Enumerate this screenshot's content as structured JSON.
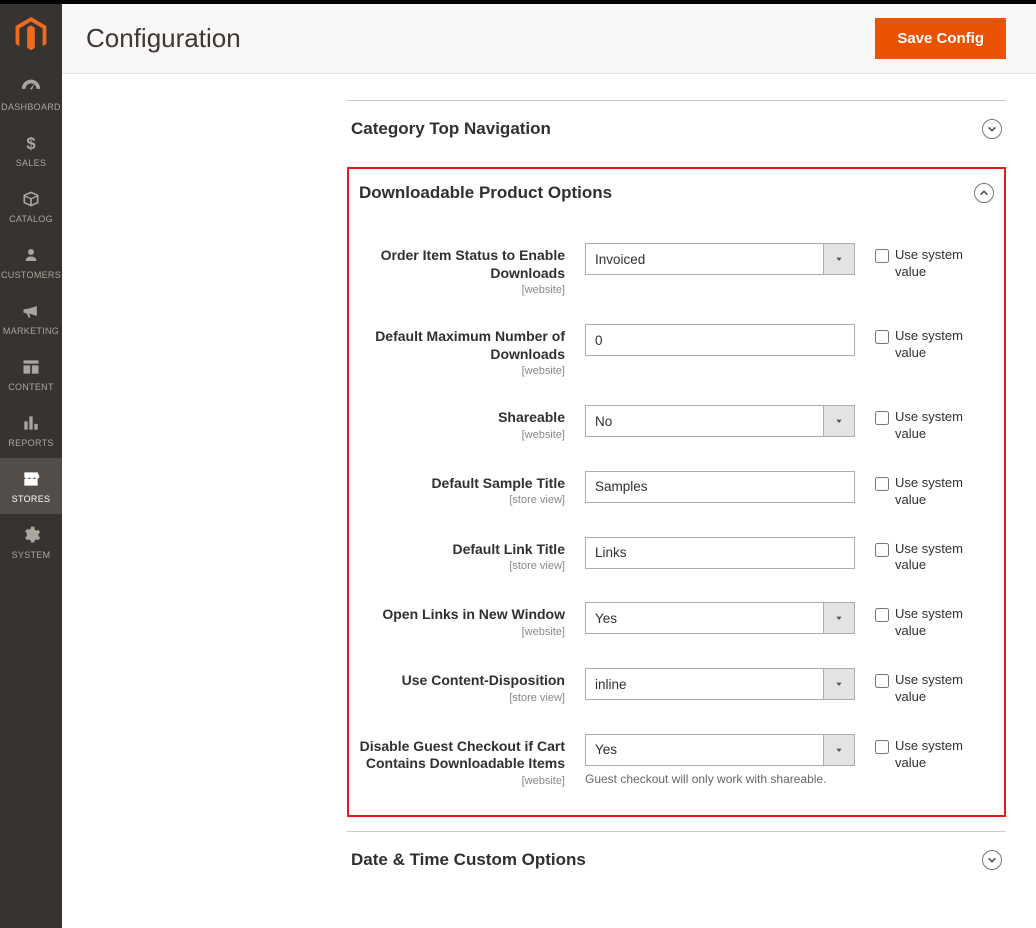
{
  "header": {
    "page_title": "Configuration",
    "save_button": "Save Config"
  },
  "sidebar": {
    "items": [
      {
        "id": "dashboard",
        "label": "DASHBOARD"
      },
      {
        "id": "sales",
        "label": "SALES"
      },
      {
        "id": "catalog",
        "label": "CATALOG"
      },
      {
        "id": "customers",
        "label": "CUSTOMERS"
      },
      {
        "id": "marketing",
        "label": "MARKETING"
      },
      {
        "id": "content",
        "label": "CONTENT"
      },
      {
        "id": "reports",
        "label": "REPORTS"
      },
      {
        "id": "stores",
        "label": "STORES",
        "active": true
      },
      {
        "id": "system",
        "label": "SYSTEM"
      }
    ]
  },
  "sections": {
    "top_nav": {
      "title": "Category Top Navigation",
      "expanded": false
    },
    "download": {
      "title": "Downloadable Product Options",
      "expanded": true
    },
    "datetime": {
      "title": "Date & Time Custom Options",
      "expanded": false
    }
  },
  "common": {
    "use_system_value": "Use system value",
    "scope_website": "[website]",
    "scope_store_view": "[store view]"
  },
  "download_fields": {
    "order_status": {
      "label": "Order Item Status to Enable Downloads",
      "scope": "website",
      "type": "select",
      "value": "Invoiced"
    },
    "max_downloads": {
      "label": "Default Maximum Number of Downloads",
      "scope": "website",
      "type": "text",
      "value": "0"
    },
    "shareable": {
      "label": "Shareable",
      "scope": "website",
      "type": "select",
      "value": "No"
    },
    "sample_title": {
      "label": "Default Sample Title",
      "scope": "store view",
      "type": "text",
      "value": "Samples"
    },
    "link_title": {
      "label": "Default Link Title",
      "scope": "store view",
      "type": "text",
      "value": "Links"
    },
    "new_window": {
      "label": "Open Links in New Window",
      "scope": "website",
      "type": "select",
      "value": "Yes"
    },
    "content_disp": {
      "label": "Use Content-Disposition",
      "scope": "store view",
      "type": "select",
      "value": "inline"
    },
    "disable_guest": {
      "label": "Disable Guest Checkout if Cart Contains Downloadable Items",
      "scope": "website",
      "type": "select",
      "value": "Yes",
      "note": "Guest checkout will only work with shareable."
    }
  }
}
